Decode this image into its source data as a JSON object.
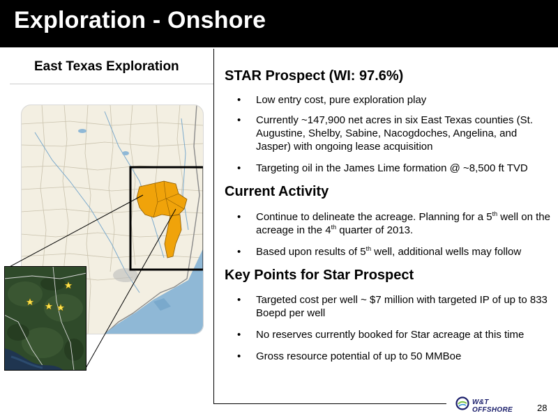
{
  "slide": {
    "title": "Exploration - Onshore",
    "page_number": "28"
  },
  "left_panel": {
    "heading": "East Texas Exploration"
  },
  "sections": [
    {
      "heading": "STAR Prospect (WI: 97.6%)",
      "bullets": [
        "Low entry cost, pure exploration play",
        "Currently ~147,900 net acres in six East Texas counties (St. Augustine, Shelby, Sabine, Nacogdoches, Angelina, and Jasper) with ongoing lease acquisition",
        "Targeting oil in the James Lime formation @ ~8,500 ft TVD"
      ]
    },
    {
      "heading": "Current Activity",
      "bullets": [
        {
          "a": "Continue to delineate the acreage.  Planning for a 5",
          "sup1": "th",
          "b": " well on the acreage in the 4",
          "sup2": "th",
          "c": " quarter of 2013."
        },
        {
          "a": "Based upon results of 5",
          "sup1": "th",
          "b": " well, additional wells may follow"
        }
      ]
    },
    {
      "heading": "Key Points for Star Prospect",
      "bullets": [
        "Targeted cost per well ~ $7 million with targeted IP of up to 833 Boepd per well",
        "No reserves currently booked for Star acreage at this time",
        "Gross resource potential of up to 50 MMBoe"
      ]
    }
  ],
  "bullet_glyph": "•",
  "logo": {
    "text": "W&T OFFSHORE",
    "icon": "wt-offshore-logo-icon"
  },
  "colors": {
    "title_bar": "#000000",
    "acreage": "#f0a30a",
    "logo_blue": "#1b1f6b",
    "logo_green": "#7dc242"
  },
  "map": {
    "icon": "east-texas-county-map",
    "inset_icon": "satellite-inset-with-well-stars"
  }
}
